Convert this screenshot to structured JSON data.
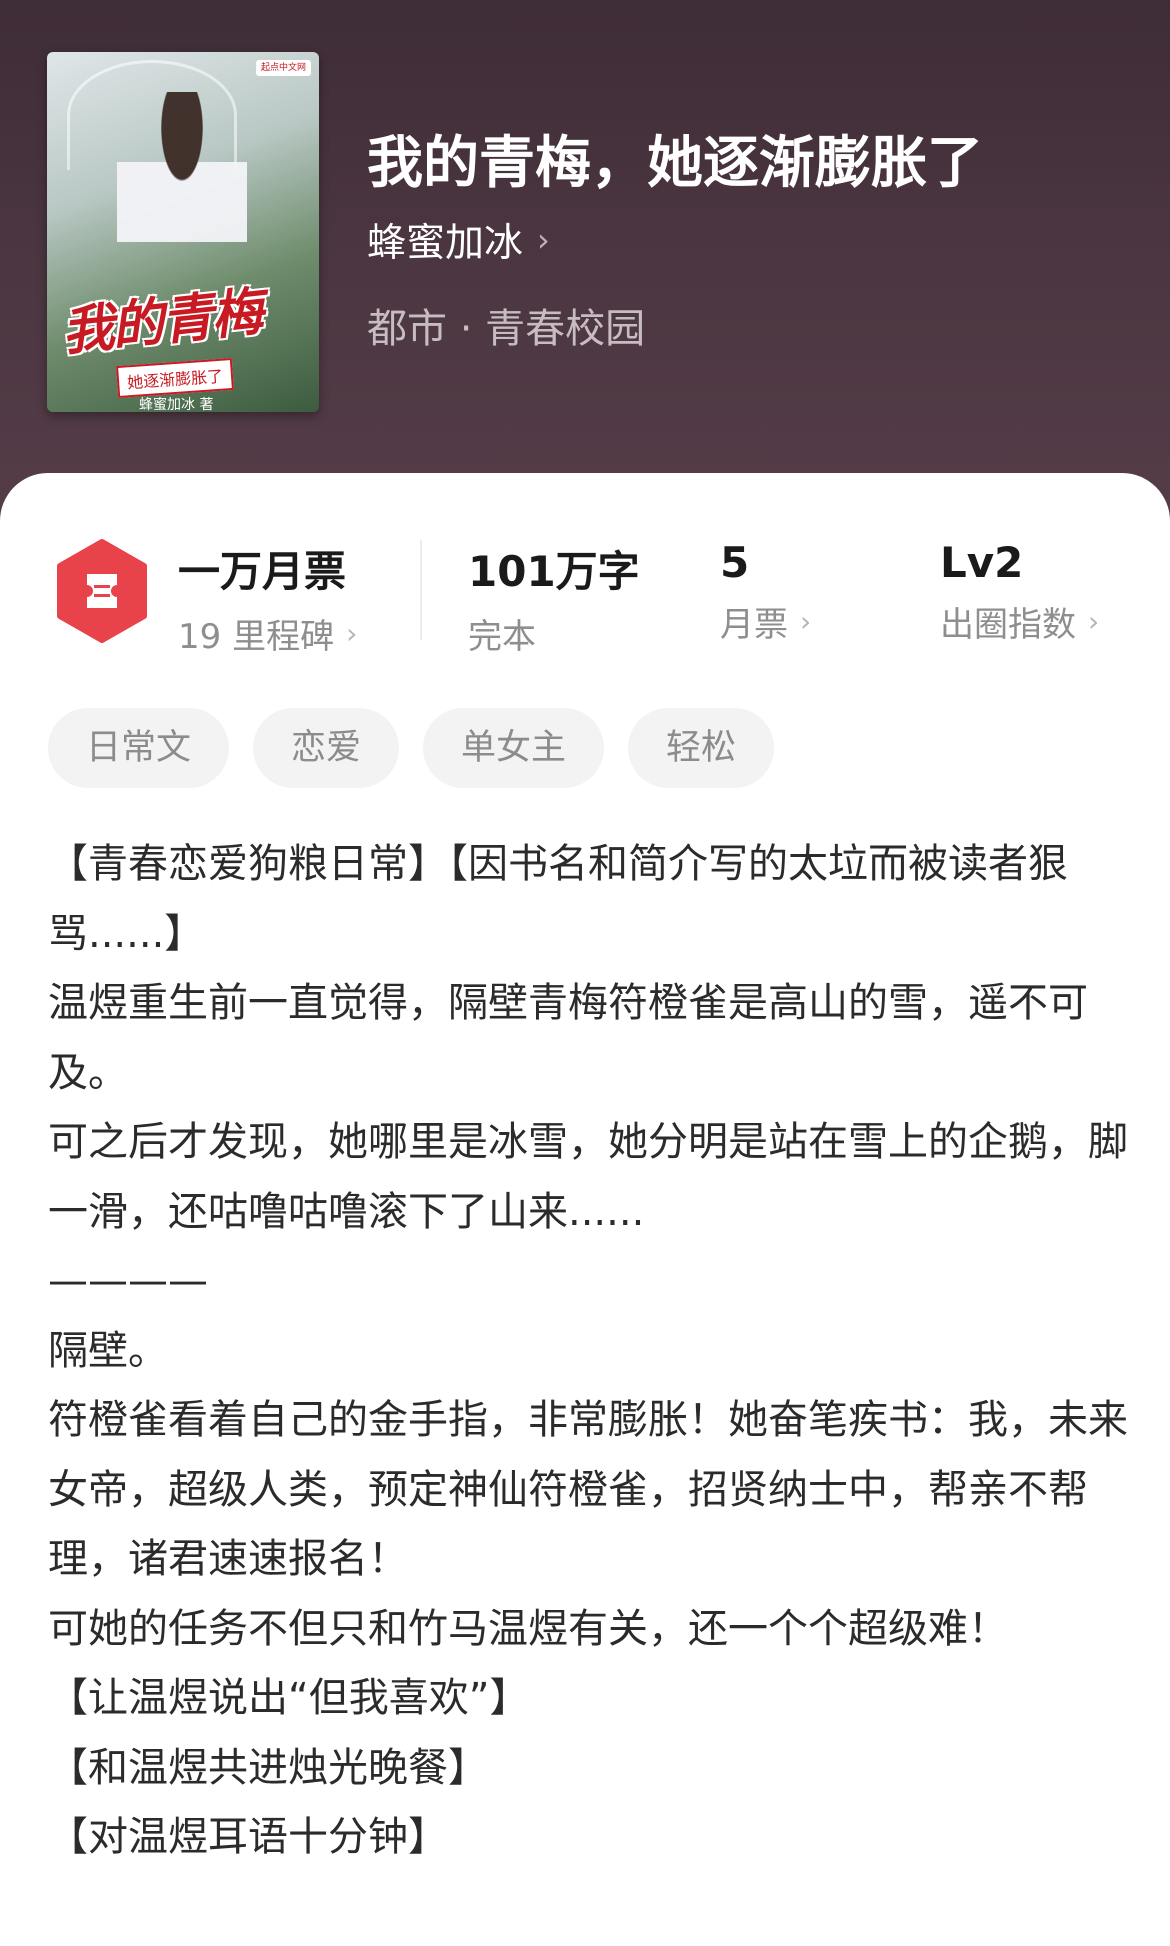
{
  "book": {
    "title": "我的青梅，她逐渐膨胀了",
    "author": "蜂蜜加冰",
    "genre": "都市 · 青春校园",
    "cover": {
      "title": "我的青梅",
      "subtitle": "她逐渐膨胀了",
      "author": "蜂蜜加冰 著",
      "badge": "起点中文网"
    }
  },
  "stats": {
    "monthly_ticket": {
      "value": "一万月票",
      "label": "19 里程碑"
    },
    "words": {
      "value": "101万字",
      "label": "完本"
    },
    "tickets": {
      "value": "5",
      "label": "月票"
    },
    "level": {
      "value": "Lv2",
      "label": "出圈指数"
    }
  },
  "tags": [
    "日常文",
    "恋爱",
    "单女主",
    "轻松"
  ],
  "description": [
    "【青春恋爱狗粮日常】【因书名和简介写的太垃而被读者狠骂......】",
    "温煜重生前一直觉得，隔壁青梅符橙雀是高山的雪，遥不可及。",
    "可之后才发现，她哪里是冰雪，她分明是站在雪上的企鹅，脚一滑，还咕噜咕噜滚下了山来......",
    "————",
    "隔壁。",
    "符橙雀看着自己的金手指，非常膨胀！她奋笔疾书：我，未来女帝，超级人类，预定神仙符橙雀，招贤纳士中，帮亲不帮理，诸君速速报名！",
    "可她的任务不但只和竹马温煜有关，还一个个超级难！",
    "【让温煜说出“但我喜欢”】",
    "【和温煜共进烛光晚餐】",
    "【对温煜耳语十分钟】"
  ],
  "colors": {
    "accent": "#e8434b",
    "header_bg": "#4a3540"
  },
  "icons": {
    "ticket": "ticket-icon",
    "chevron": "chevron-right-icon"
  }
}
